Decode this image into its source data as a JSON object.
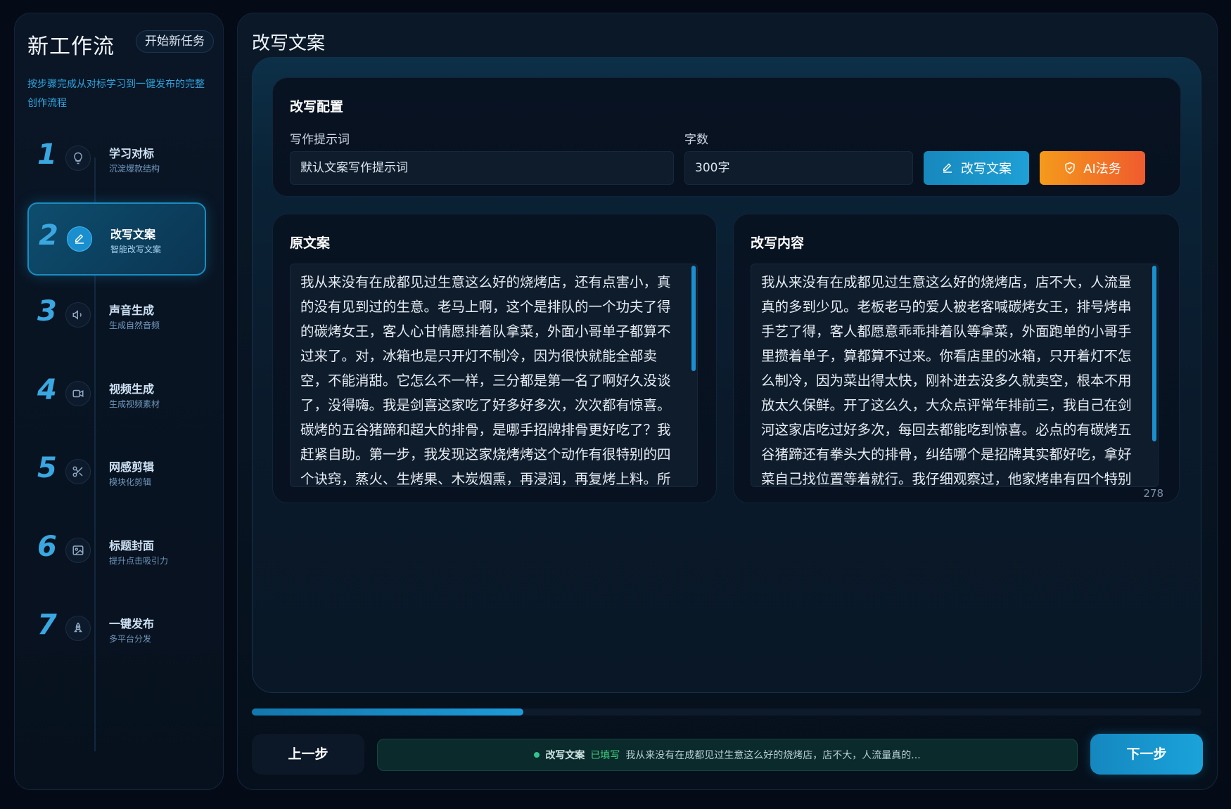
{
  "sidebar": {
    "title": "新工作流",
    "new_task_label": "开始新任务",
    "description": "按步骤完成从对标学习到一键发布的完整创作流程",
    "steps": [
      {
        "num": "1",
        "label": "学习对标",
        "sub": "沉淀爆款结构",
        "icon": "lightbulb-icon",
        "active": false
      },
      {
        "num": "2",
        "label": "改写文案",
        "sub": "智能改写文案",
        "icon": "pen-icon",
        "active": true
      },
      {
        "num": "3",
        "label": "声音生成",
        "sub": "生成自然音频",
        "icon": "speaker-icon",
        "active": false
      },
      {
        "num": "4",
        "label": "视频生成",
        "sub": "生成视频素材",
        "icon": "video-camera-icon",
        "active": false
      },
      {
        "num": "5",
        "label": "网感剪辑",
        "sub": "模块化剪辑",
        "icon": "scissors-icon",
        "active": false
      },
      {
        "num": "6",
        "label": "标题封面",
        "sub": "提升点击吸引力",
        "icon": "image-icon",
        "active": false
      },
      {
        "num": "7",
        "label": "一键发布",
        "sub": "多平台分发",
        "icon": "rocket-icon",
        "active": false
      }
    ]
  },
  "main": {
    "title": "改写文案",
    "config": {
      "title": "改写配置",
      "prompt_label": "写作提示词",
      "prompt_value": "默认文案写作提示词",
      "count_label": "字数",
      "count_value": "300字",
      "rewrite_button": "改写文案",
      "legal_button": "AI法务"
    },
    "original": {
      "title": "原文案",
      "text": "我从来没有在成都见过生意这么好的烧烤店，还有点害小，真的没有见到过的生意。老马上啊，这个是排队的一个功夫了得的碳烤女王，客人心甘情愿排着队拿菜，外面小哥单子都算不过来了。对，冰箱也是只开灯不制冷，因为很快就能全部卖空，不能消甜。它怎么不一样，三分都是第一名了啊好久没谈了，没得嗨。我是剑喜这家吃了好多好多次，次次都有惊喜。碳烤的五谷猪蹄和超大的排骨，是哪手招牌排骨更好吃了？我赶紧自助。第一步，我发现这家烧烤烤这个动作有很特别的四个诀窍，蒸火、生烤果、木炭烟熏，再浸润，再复烤上料。所"
    },
    "rewritten": {
      "title": "改写内容",
      "text": "我从来没有在成都见过生意这么好的烧烤店，店不大，人流量真的多到少见。老板老马的爱人被老客喊碳烤女王，排号烤串手艺了得，客人都愿意乖乖排着队等拿菜，外面跑单的小哥手里攒着单子，算都算不过来。你看店里的冰箱，只开着灯不怎么制冷，因为菜出得太快，刚补进去没多久就卖空，根本不用放太久保鲜。开了这么久，大众点评常年排前三，我自己在剑河这家店吃过好多次，每回去都能吃到惊喜。必点的有碳烤五谷猪蹄还有拳头大的排骨，纠结哪个是招牌其实都好吃，拿好菜自己找位置等着就行。我仔细观察过，他家烤串有四个特别",
      "char_count": "278"
    },
    "progress": 0.286,
    "footer": {
      "prev_label": "上一步",
      "status_step": "改写文案",
      "status_state": "已填写",
      "status_text": "我从来没有在成都见过生意这么好的烧烤店，店不大，人流量真的...",
      "next_label": "下一步"
    }
  },
  "colors": {
    "accent": "#1a8fd0",
    "legal_gradient_start": "#f59a1b",
    "legal_gradient_end": "#ef5b2e",
    "status_green": "#3fd07f"
  }
}
